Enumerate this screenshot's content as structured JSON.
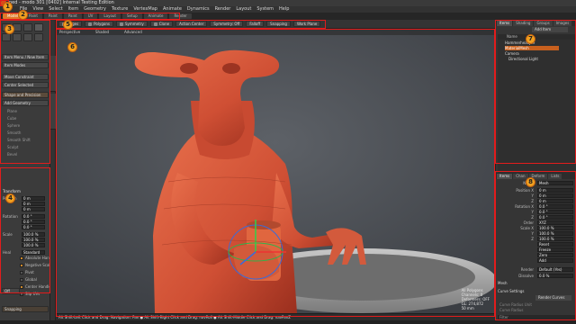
{
  "title": {
    "text": "ned - modo 301 [0402] Internal Testing Edition"
  },
  "menu": [
    "File",
    "View",
    "Select",
    "Item",
    "Geometry",
    "Texture",
    "VertexMap",
    "Animate",
    "Dynamics",
    "Render",
    "Layout",
    "System",
    "Help"
  ],
  "tabs": [
    "Model",
    "Paint",
    "Paint",
    "Paint",
    "UV",
    "Layout",
    "Setup",
    "Animate",
    "Render"
  ],
  "left_panel": {
    "dropdown1": "Item Menu / New Item",
    "dropdown2": "Item Modes",
    "dropdown3": "Move Constraint",
    "dropdown4": "Center Selected",
    "section1": "Shape and Precision",
    "section2": "Add Geometry",
    "menu_items": [
      "Plane",
      "Cube",
      "Sphere",
      "Smooth",
      "Smooth Shift",
      "Sculpt",
      "Bevel"
    ],
    "transform_label": "Transform",
    "position_label": "Position",
    "rotation_label": "Rotation",
    "scale_label": "Scale",
    "position": [
      "0 m",
      "0 m",
      "0 m"
    ],
    "rotation": [
      "0.0 °",
      "0.0 °",
      "0.0 °"
    ],
    "scale": [
      "100.0 %",
      "100.0 %",
      "100.0 %"
    ],
    "heal_label": "Heal",
    "heal_value": "Standard",
    "options": [
      "Absolute Handle",
      "Negative Scale",
      "Pivot",
      "Global",
      "Center Handle",
      "Slip UVs"
    ],
    "snapping_label": "Snapping",
    "snap_value": "Off"
  },
  "viewport_toolbar": [
    "Edges",
    "Polygons",
    "Symmetry",
    "Clone",
    "Action Center",
    "Symmetry: Off",
    "Falloff",
    "Snapping",
    "Work Plane"
  ],
  "viewport": {
    "header_left": "Perspective",
    "header_mid": "Shaded",
    "header_right": "Advanced",
    "stats": [
      "All Polygons",
      "Channels: 0",
      "Deformers: OFF",
      "GL: 274,872",
      "50 mm"
    ]
  },
  "status": {
    "text": "Alt Shift-Left Click and Drag: Navigation: Pan  ●  Alt Shift-Right Click and Drag: navRoll  ●  Alt Shift-Middle Click and Drag: navPanZ"
  },
  "right_panel": {
    "tabs_top": [
      "Items",
      "Shading",
      "Groups",
      "Images"
    ],
    "add_item": "Add Item",
    "list_header": "Name",
    "items": [
      "HammerheadJoe",
      "MaterialMesh",
      "Camera",
      "Directional Light"
    ],
    "tabs_bottom": [
      "Items",
      "Chan",
      "Deform",
      "Lists"
    ],
    "props_name_label": "Name",
    "props_name": "Mesh",
    "props": [
      {
        "k": "Position X",
        "v": "0 m"
      },
      {
        "k": "Y",
        "v": "0 m"
      },
      {
        "k": "Z",
        "v": "0 m"
      },
      {
        "k": "Rotation X",
        "v": "0.0 °"
      },
      {
        "k": "Y",
        "v": "0.0 °"
      },
      {
        "k": "Z",
        "v": "0.0 °"
      },
      {
        "k": "Order",
        "v": "XYZ"
      },
      {
        "k": "Scale X",
        "v": "100.0 %"
      },
      {
        "k": "Y",
        "v": "100.0 %"
      },
      {
        "k": "Z",
        "v": "100.0 %"
      },
      {
        "k": "",
        "v": "Reset"
      },
      {
        "k": "",
        "v": "Freeze"
      },
      {
        "k": "",
        "v": "Zero"
      },
      {
        "k": "",
        "v": "Add"
      }
    ],
    "render_label": "Render",
    "render_value": "Default (Yes)",
    "dissolve_label": "Dissolve",
    "dissolve_value": "0.0 %",
    "mesh_section": "Mesh",
    "curve_section": "Curve Settings",
    "render_curves": "Render Curves",
    "curve_radius": "Curve Radius Unit",
    "curve_radius2": "Curve Radius",
    "filter_label": "Filter"
  },
  "annotations": [
    "1",
    "2",
    "3",
    "4",
    "5",
    "6",
    "7",
    "8"
  ],
  "colors": {
    "accent": "#e07a2a",
    "highlight": "#e21c1c",
    "badge": "#f0a020",
    "model_skin": "#d8573a"
  }
}
